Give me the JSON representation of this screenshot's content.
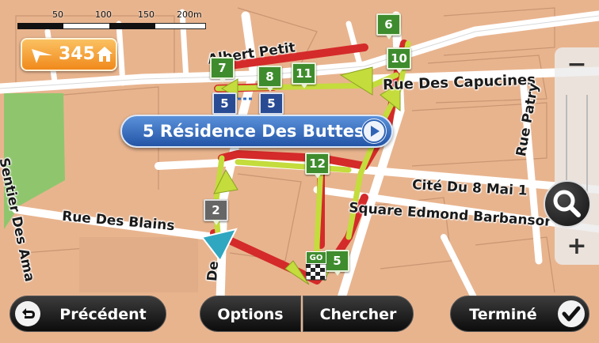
{
  "scale": {
    "labels": [
      "50",
      "100",
      "150",
      "200m"
    ]
  },
  "home_badge": {
    "distance": "345",
    "arrow_icon": "route-arrow-icon",
    "home_icon": "house-icon"
  },
  "location_bubble": {
    "text": "5 Résidence Des Buttes",
    "icon": "play-icon"
  },
  "streets": {
    "albert_petit": "Albert Petit",
    "capucines": "Rue Des Capucines",
    "patry": "Rue Patry",
    "cite": "Cité Du 8 Mai 1",
    "square": "Square Edmond Barbansor",
    "blains": "Rue Des Blains",
    "sentier": "Sentier Des Ama",
    "de": "De"
  },
  "markers": [
    "2",
    "5",
    "6",
    "7",
    "8",
    "10",
    "11",
    "12",
    "5",
    "5"
  ],
  "start_flag": "GO",
  "zoom": {
    "out": "−",
    "in": "+",
    "search_icon": "magnifier-icon"
  },
  "buttons": {
    "back": "Précédent",
    "options": "Options",
    "search": "Chercher",
    "done": "Terminé"
  },
  "colors": {
    "map_block": "#e8b48e",
    "road": "#ffffff",
    "park": "#8fc66d",
    "route_red": "#d42a2a",
    "route_green": "#c4dc3c",
    "marker_green": "#3f8c2e",
    "bubble_blue": "#2f64b5",
    "home_orange": "#f39a26"
  }
}
